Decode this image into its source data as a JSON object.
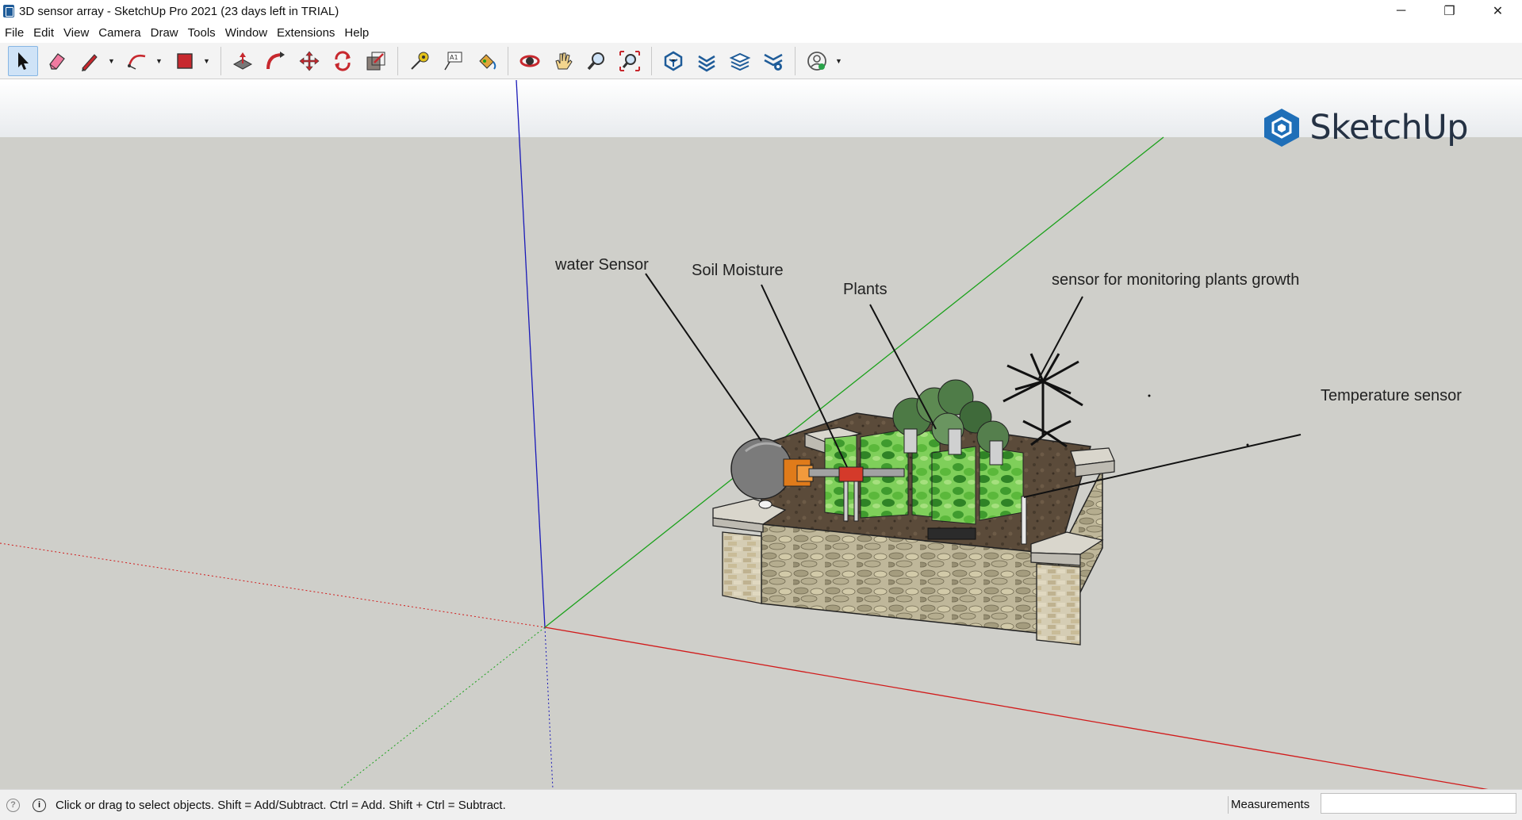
{
  "window": {
    "title": "3D sensor array - SketchUp Pro 2021 (23 days left in TRIAL)",
    "minimize": "─",
    "restore": "❐",
    "close": "✕"
  },
  "menu": [
    "File",
    "Edit",
    "View",
    "Camera",
    "Draw",
    "Tools",
    "Window",
    "Extensions",
    "Help"
  ],
  "toolbar": {
    "tools": [
      "select",
      "eraser",
      "line",
      "arc",
      "rectangle",
      "push-pull",
      "follow-me",
      "move",
      "rotate",
      "scale",
      "tape-measure",
      "text",
      "paint-bucket",
      "orbit",
      "pan",
      "zoom",
      "zoom-extents",
      "3d-warehouse",
      "extension-warehouse",
      "layout",
      "extension-manager",
      "trimble-connect"
    ]
  },
  "viewport": {
    "logo_text": "SketchUp",
    "labels": {
      "water_sensor": "water Sensor",
      "soil_moisture": "Soil Moisture",
      "plants": "Plants",
      "growth_sensor": "sensor for monitoring plants growth",
      "temperature_sensor": "Temperature sensor"
    },
    "axis_colors": {
      "red": "#d11a1a",
      "green": "#1aa11a",
      "blue": "#1a1ab8"
    }
  },
  "status": {
    "hint": "Click or drag to select objects. Shift = Add/Subtract. Ctrl = Add. Shift + Ctrl = Subtract.",
    "measurements_label": "Measurements",
    "measurements_value": ""
  }
}
